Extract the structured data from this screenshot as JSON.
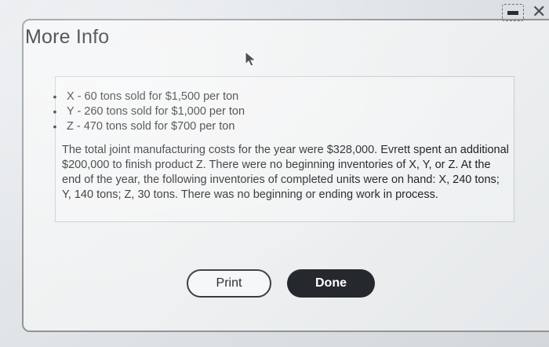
{
  "dialog": {
    "title": "More Info",
    "bullets": [
      "X - 60 tons sold for $1,500 per ton",
      "Y - 260 tons sold for $1,000 per ton",
      "Z - 470 tons sold for $700 per ton"
    ],
    "paragraph": "The total joint manufacturing costs for the year were $328,000. Evrett spent an additional $200,000 to finish product Z. There were no beginning inventories of X, Y, or Z. At the end of the year, the following inventories of completed units were on hand: X, 240 tons; Y, 140 tons; Z, 30 tons. There was no beginning or ending work in process.",
    "buttons": {
      "print": "Print",
      "done": "Done"
    },
    "window_controls": {
      "minimize_icon": "minimize-icon",
      "close_icon": "close-icon",
      "close_glyph": "✕"
    }
  },
  "colors": {
    "primary_button": "#25282c",
    "secondary_button_border": "#3a3d40",
    "text": "#1e1f21"
  }
}
